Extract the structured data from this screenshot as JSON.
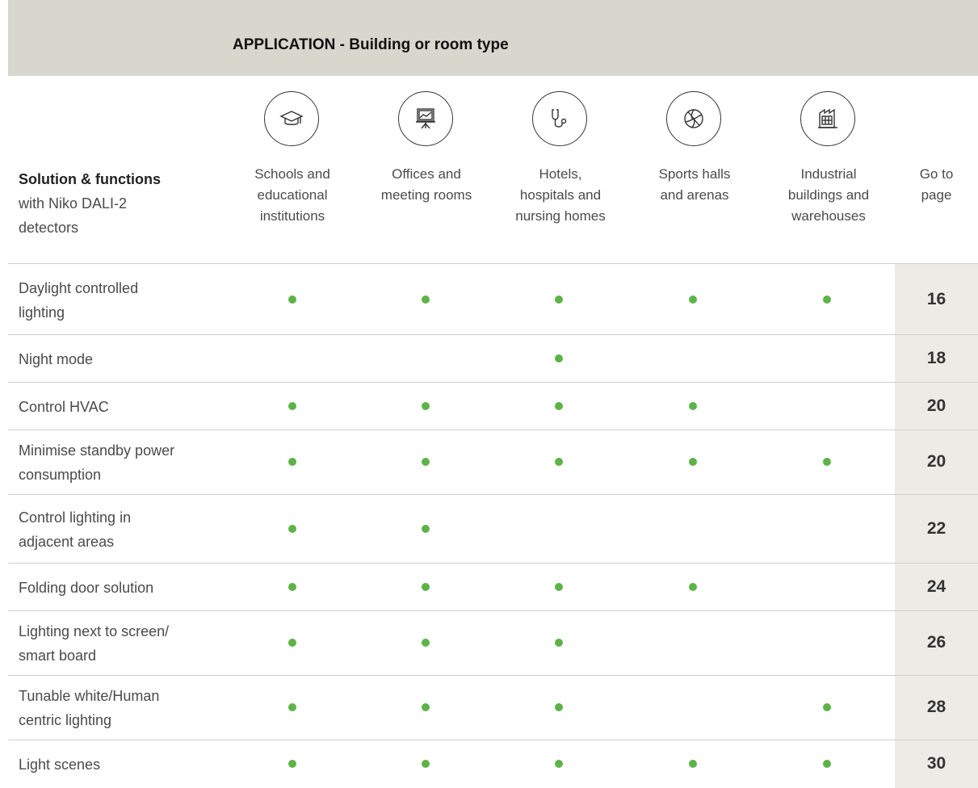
{
  "header": {
    "title": "APPLICATION - Building or room type"
  },
  "columns": {
    "solution": {
      "title": "Solution & functions",
      "subtitle_1": "with Niko DALI-2",
      "subtitle_2": "detectors"
    },
    "schools": {
      "icon": "graduation-cap-icon",
      "line1": "Schools and",
      "line2": "educational",
      "line3": "institutions"
    },
    "offices": {
      "icon": "presentation-board-icon",
      "line1": "Offices and",
      "line2": "meeting rooms"
    },
    "hotels": {
      "icon": "stethoscope-icon",
      "line1": "Hotels,",
      "line2": "hospitals and",
      "line3": "nursing homes"
    },
    "sports": {
      "icon": "volleyball-icon",
      "line1": "Sports halls",
      "line2": "and arenas"
    },
    "industrial": {
      "icon": "factory-icon",
      "line1": "Industrial",
      "line2": "buildings and",
      "line3": "warehouses"
    },
    "goto": {
      "line1": "Go to",
      "line2": "page"
    }
  },
  "rows": [
    {
      "label_1": "Daylight controlled",
      "label_2": "lighting",
      "applies": [
        true,
        true,
        true,
        true,
        true
      ],
      "page": "16"
    },
    {
      "label_1": "Night mode",
      "applies": [
        false,
        false,
        true,
        false,
        false
      ],
      "page": "18"
    },
    {
      "label_1": "Control HVAC",
      "applies": [
        true,
        true,
        true,
        true,
        false
      ],
      "page": "20"
    },
    {
      "label_1": "Minimise standby power",
      "label_2": "consumption",
      "applies": [
        true,
        true,
        true,
        true,
        true
      ],
      "page": "20"
    },
    {
      "label_1": "Control lighting in",
      "label_2": "adjacent areas",
      "applies": [
        true,
        true,
        false,
        false,
        false
      ],
      "page": "22"
    },
    {
      "label_1": "Folding door solution",
      "applies": [
        true,
        true,
        true,
        true,
        false
      ],
      "page": "24"
    },
    {
      "label_1": "Lighting next to screen/",
      "label_2": "smart board",
      "applies": [
        true,
        true,
        true,
        false,
        false
      ],
      "page": "26"
    },
    {
      "label_1": "Tunable white/Human",
      "label_2": "centric lighting",
      "applies": [
        true,
        true,
        true,
        false,
        true
      ],
      "page": "28"
    },
    {
      "label_1": "Light scenes",
      "applies": [
        true,
        true,
        true,
        true,
        true
      ],
      "page": "30"
    }
  ],
  "colors": {
    "dot": "#5db347",
    "banner": "#d8d7ce",
    "goto_background": "#ecebe5"
  }
}
